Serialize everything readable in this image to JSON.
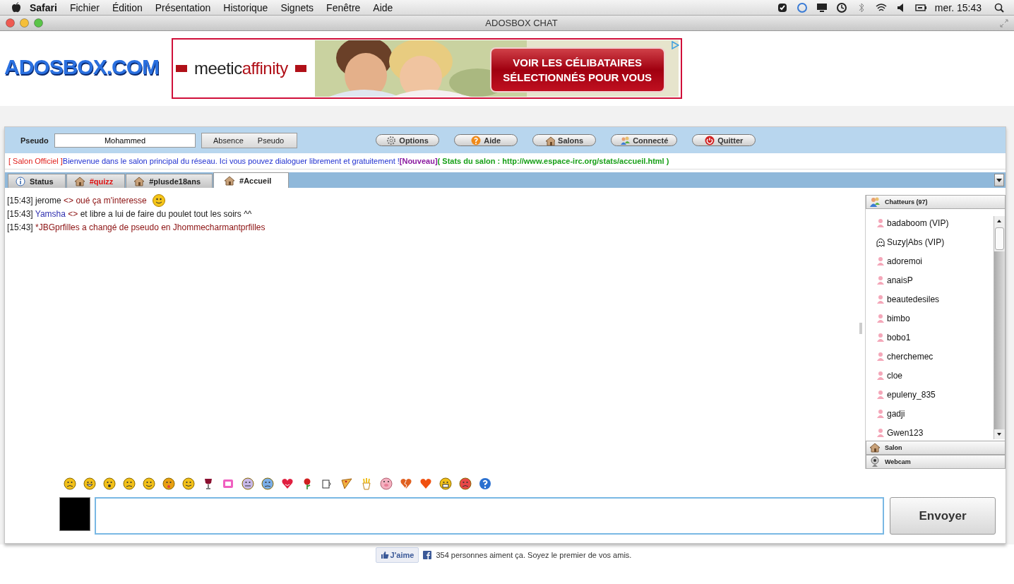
{
  "menubar": {
    "app": "Safari",
    "items": [
      "Fichier",
      "Édition",
      "Présentation",
      "Historique",
      "Signets",
      "Fenêtre",
      "Aide"
    ],
    "clock": "mer. 15:43"
  },
  "window": {
    "title": "ADOSBOX CHAT"
  },
  "header": {
    "logo": "ADOSBOX.COM",
    "ad": {
      "brand_prefix": "meetic",
      "brand_suffix": "affinity",
      "cta": [
        "VOIR LES CÉLIBATAIRES",
        "SÉLECTIONNÉS POUR VOUS"
      ],
      "photo": {
        "kind": "picture"
      }
    }
  },
  "toolbar": {
    "pseudo_label": "Pseudo",
    "pseudo_value": "Mohammed",
    "toggles": [
      "Absence",
      "Pseudo"
    ],
    "buttons": [
      {
        "kind": "options",
        "label": "Options"
      },
      {
        "kind": "help",
        "label": "Aide"
      },
      {
        "kind": "rooms",
        "label": "Salons"
      },
      {
        "kind": "connected",
        "label": "Connecté"
      },
      {
        "kind": "quit",
        "label": "Quitter"
      }
    ]
  },
  "topic": [
    {
      "text": "[ Salon Officiel ]",
      "color": "#e0201c",
      "bold": false
    },
    {
      "text": "Bienvenue dans le salon principal du réseau. Ici vous pouvez dialoguer librement et gratuitement !",
      "color": "#1f2fd0",
      "bold": false
    },
    {
      "text": "[Nouveau]",
      "color": "#8a1aa0",
      "bold": true
    },
    {
      "text": "( Stats du salon : http://www.espace-irc.org/stats/accueil.html )",
      "color": "#18a018",
      "bold": true
    }
  ],
  "tabs": [
    {
      "kind": "status",
      "label": "Status",
      "selected": false,
      "highlighted": false
    },
    {
      "kind": "room",
      "label": "#quizz",
      "selected": false,
      "highlighted": true
    },
    {
      "kind": "room",
      "label": "#plusde18ans",
      "selected": false,
      "highlighted": false
    },
    {
      "kind": "room",
      "label": "#Accueil",
      "selected": true,
      "highlighted": false
    }
  ],
  "messages": [
    {
      "kind": "message",
      "time": "[15:43]",
      "nick": {
        "text": "jerome",
        "color": "#1a1a1a"
      },
      "separator": "<>",
      "body": {
        "text": "oué ça m'interesse",
        "color": "#8b1010"
      },
      "smiley": true
    },
    {
      "kind": "message",
      "time": "[15:43]",
      "nick": {
        "text": "Yamsha",
        "color": "#3030b0"
      },
      "separator": "<>",
      "body": {
        "text": "et libre a lui de faire du poulet tout les soirs ^^",
        "color": "#1a1a1a"
      },
      "smiley": false
    },
    {
      "kind": "event",
      "time": "[15:43]",
      "body": {
        "text": "*JBGprfilles a changé de pseudo en Jhommecharmantprfilles",
        "color": "#8b1010"
      }
    }
  ],
  "users_panel": {
    "title": "Chatteurs (97)",
    "users": [
      {
        "name": "badaboom (VIP)",
        "kind": "user"
      },
      {
        "name": "Suzy|Abs (VIP)",
        "kind": "away"
      },
      {
        "name": "adoremoi",
        "kind": "user"
      },
      {
        "name": "anaisP",
        "kind": "user"
      },
      {
        "name": "beautedesiles",
        "kind": "user"
      },
      {
        "name": "bimbo",
        "kind": "user"
      },
      {
        "name": "bobo1",
        "kind": "user"
      },
      {
        "name": "cherchemec",
        "kind": "user"
      },
      {
        "name": "cloe",
        "kind": "user"
      },
      {
        "name": "epuleny_835",
        "kind": "user"
      },
      {
        "name": "gadji",
        "kind": "user"
      },
      {
        "name": "Gwen123",
        "kind": "user"
      }
    ],
    "sections": [
      {
        "kind": "room",
        "label": "Salon"
      },
      {
        "kind": "webcam",
        "label": "Webcam"
      }
    ]
  },
  "composer": {
    "color": "#000000",
    "send": "Envoyer"
  },
  "footer": {
    "like": "J'aime",
    "text": "354 personnes aiment ça. Soyez le premier de vos amis."
  }
}
